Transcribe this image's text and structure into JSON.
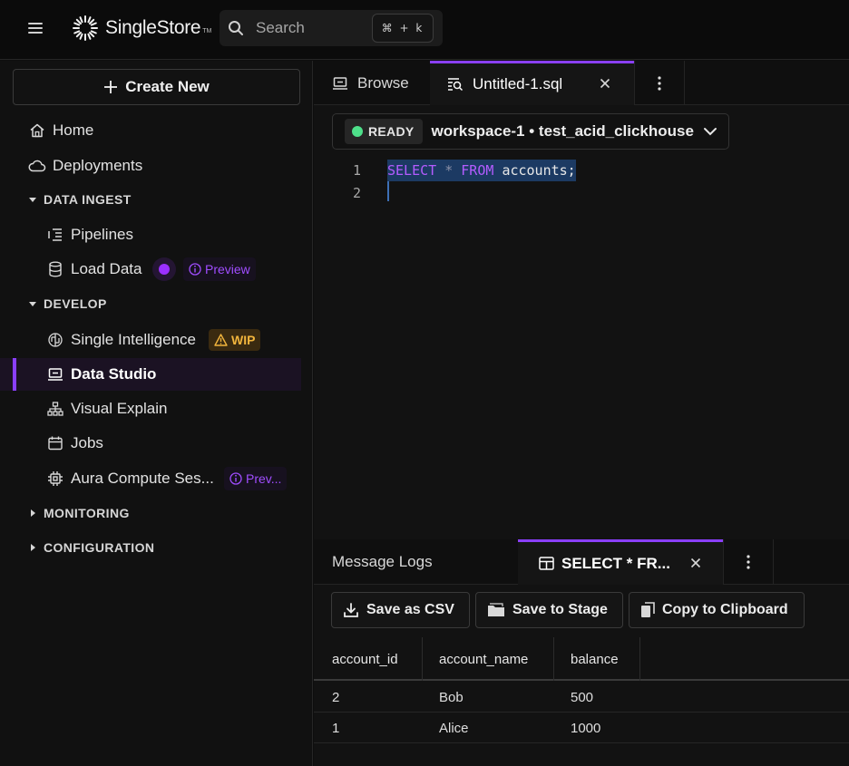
{
  "app": {
    "brand": "SingleStore",
    "trademark": "TM"
  },
  "search": {
    "placeholder": "Search",
    "shortcut": "⌘ + k"
  },
  "sidebar": {
    "create_label": "Create New",
    "home": "Home",
    "deployments": "Deployments",
    "section_data_ingest": "DATA INGEST",
    "pipelines": "Pipelines",
    "load_data": "Load Data",
    "load_data_badge": "Preview",
    "section_develop": "DEVELOP",
    "single_intelligence": "Single Intelligence",
    "single_intelligence_badge": "WIP",
    "data_studio": "Data Studio",
    "visual_explain": "Visual Explain",
    "jobs": "Jobs",
    "aura_compute": "Aura Compute Ses...",
    "aura_badge": "Prev...",
    "section_monitoring": "MONITORING",
    "section_configuration": "CONFIGURATION"
  },
  "editor_tabs": {
    "browse": "Browse",
    "file": "Untitled-1.sql"
  },
  "workspace": {
    "status": "READY",
    "label": "workspace-1  •  test_acid_clickhouse"
  },
  "editor": {
    "line_numbers": [
      "1",
      "2"
    ],
    "query": {
      "kw1": "SELECT",
      "star": "*",
      "kw2": "FROM",
      "table": "accounts;"
    }
  },
  "results": {
    "tab_logs": "Message Logs",
    "tab_query": "SELECT * FR...",
    "btn_csv": "Save as CSV",
    "btn_stage": "Save to Stage",
    "btn_clipboard": "Copy to Clipboard",
    "columns": [
      "account_id",
      "account_name",
      "balance"
    ],
    "rows": [
      [
        "2",
        "Bob",
        "500"
      ],
      [
        "1",
        "Alice",
        "1000"
      ]
    ]
  },
  "colors": {
    "accent": "#8a3ffc",
    "ready": "#4ee08a",
    "wip": "#f1b43c",
    "selection": "#1c3a63"
  }
}
